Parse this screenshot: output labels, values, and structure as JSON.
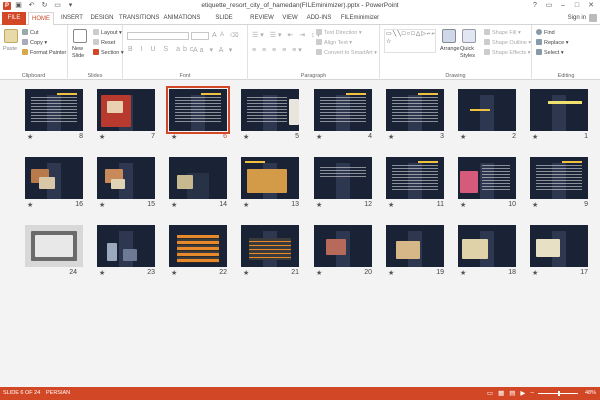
{
  "window": {
    "title": "etiquette_resort_city_of_hamedan(FILEminimizer).pptx - PowerPoint",
    "signin": "Sign in"
  },
  "tabs": [
    "FILE",
    "HOME",
    "INSERT",
    "DESIGN",
    "TRANSITIONS",
    "ANIMATIONS",
    "SLIDE SHOW",
    "REVIEW",
    "VIEW",
    "ADD-INS",
    "FILEminimizer"
  ],
  "ribbon": {
    "clipboard": {
      "label": "Clipboard",
      "paste": "Paste",
      "cut": "Cut",
      "copy": "Copy",
      "format_painter": "Format Painter"
    },
    "slides": {
      "label": "Slides",
      "new_slide": "New Slide",
      "layout": "Layout",
      "reset": "Reset",
      "section": "Section"
    },
    "font": {
      "label": "Font"
    },
    "paragraph": {
      "label": "Paragraph",
      "text_direction": "Text Direction",
      "align_text": "Align Text",
      "convert_smartart": "Convert to SmartArt"
    },
    "drawing": {
      "label": "Drawing",
      "arrange": "Arrange",
      "quick_styles": "Quick Styles",
      "shape_fill": "Shape Fill",
      "shape_outline": "Shape Outline",
      "shape_effects": "Shape Effects"
    },
    "editing": {
      "label": "Editing",
      "find": "Find",
      "replace": "Replace",
      "select": "Select"
    }
  },
  "slides": [
    {
      "num": "1"
    },
    {
      "num": "2"
    },
    {
      "num": "3"
    },
    {
      "num": "4"
    },
    {
      "num": "5"
    },
    {
      "num": "6"
    },
    {
      "num": "7"
    },
    {
      "num": "8"
    },
    {
      "num": "9"
    },
    {
      "num": "10"
    },
    {
      "num": "11"
    },
    {
      "num": "12"
    },
    {
      "num": "13"
    },
    {
      "num": "14"
    },
    {
      "num": "15"
    },
    {
      "num": "16"
    },
    {
      "num": "17"
    },
    {
      "num": "18"
    },
    {
      "num": "19"
    },
    {
      "num": "20"
    },
    {
      "num": "21"
    },
    {
      "num": "22"
    },
    {
      "num": "23"
    },
    {
      "num": "24"
    }
  ],
  "star_glyph": "★",
  "status": {
    "slide_of": "SLIDE 6 OF 24",
    "language": "PERSIAN",
    "zoom": "48%"
  },
  "colors": {
    "accent": "#d24726",
    "slide_bg": "#1a2236",
    "selected_outline": "#d24726"
  }
}
